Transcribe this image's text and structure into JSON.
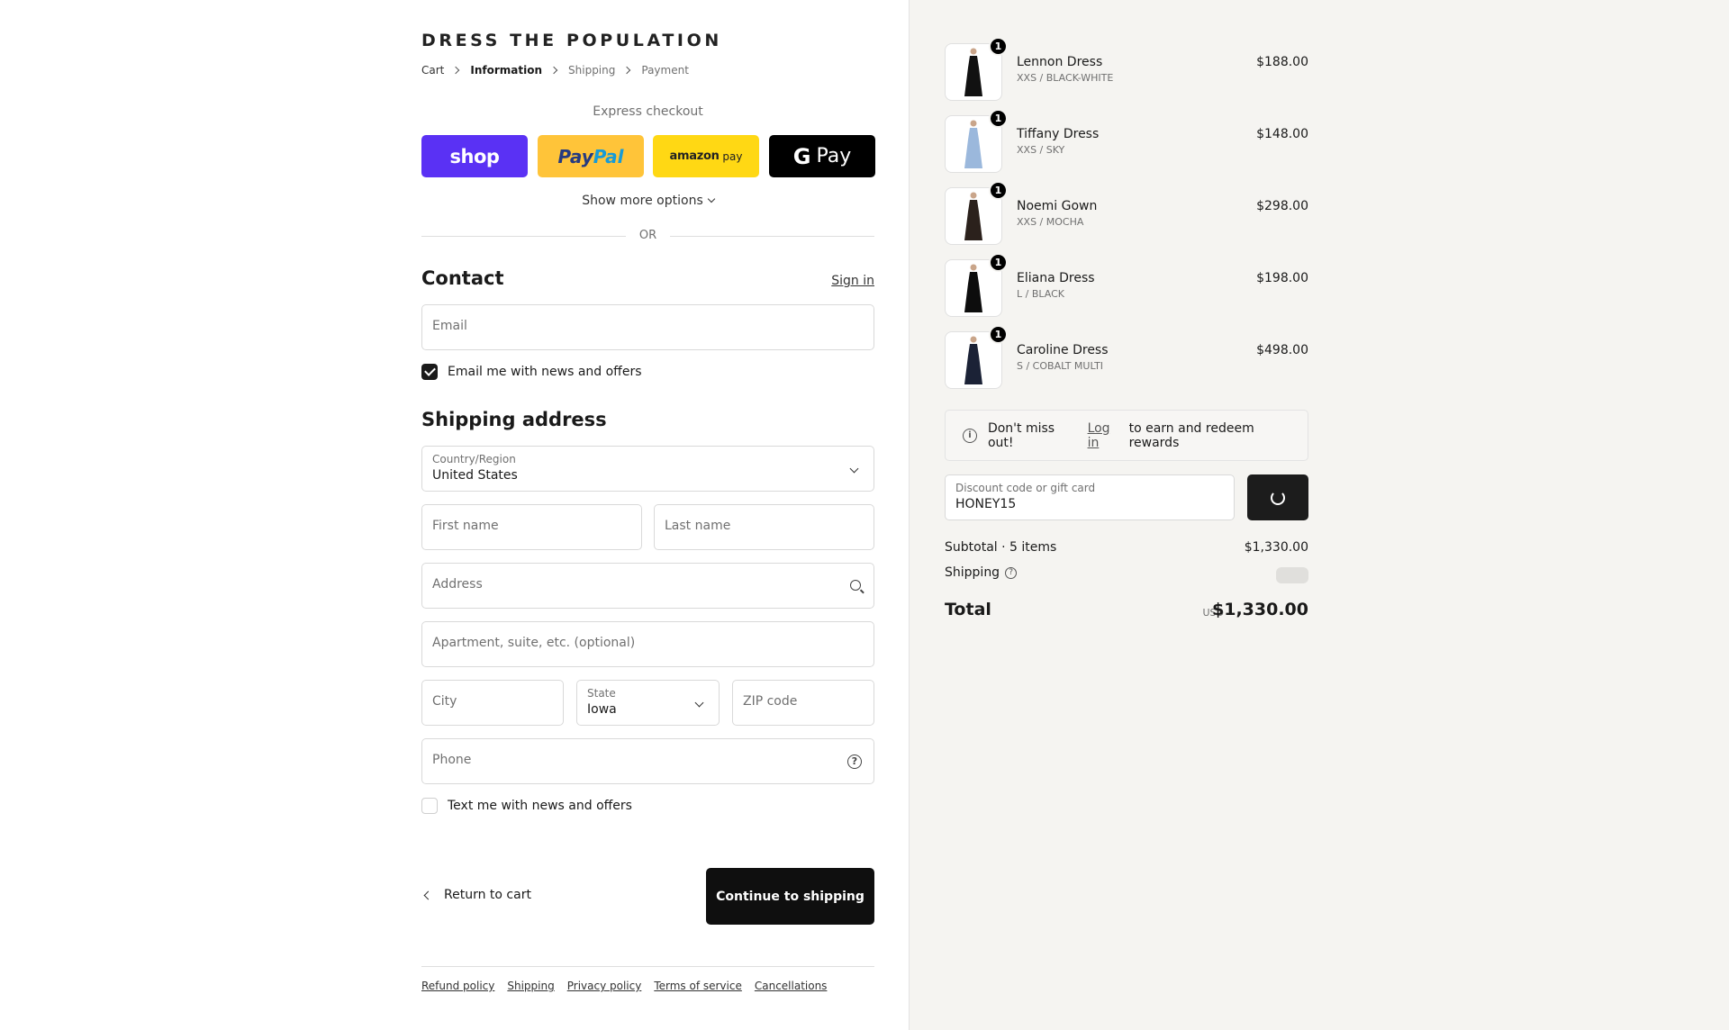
{
  "brand": "DRESS THE POPULATION",
  "breadcrumb": [
    "Cart",
    "Information",
    "Shipping",
    "Payment"
  ],
  "express": {
    "title": "Express checkout",
    "shop": "shop",
    "paypal_a": "Pay",
    "paypal_b": "Pal",
    "amazon_a": "amazon",
    "amazon_b": "pay",
    "gpay_g": "G",
    "gpay": "Pay",
    "more": "Show more options",
    "or": "OR"
  },
  "contact": {
    "heading": "Contact",
    "signin": "Sign in",
    "email_placeholder": "Email",
    "news_label": "Email me with news and offers"
  },
  "shipping_address": {
    "heading": "Shipping address",
    "country_label": "Country/Region",
    "country_value": "United States",
    "first_name": "First name",
    "last_name": "Last name",
    "address": "Address",
    "apartment": "Apartment, suite, etc. (optional)",
    "city": "City",
    "state_label": "State",
    "state_value": "Iowa",
    "zip": "ZIP code",
    "phone": "Phone",
    "text_label": "Text me with news and offers"
  },
  "actions": {
    "return": "Return to cart",
    "continue": "Continue to shipping"
  },
  "footer_links": [
    "Refund policy",
    "Shipping",
    "Privacy policy",
    "Terms of service",
    "Cancellations"
  ],
  "cart_items": [
    {
      "qty": "1",
      "name": "Lennon Dress",
      "variant": "XXS / BLACK-WHITE",
      "price": "$188.00",
      "dress_color": "#111111"
    },
    {
      "qty": "1",
      "name": "Tiffany Dress",
      "variant": "XXS / SKY",
      "price": "$148.00",
      "dress_color": "#9bb8dc"
    },
    {
      "qty": "1",
      "name": "Noemi Gown",
      "variant": "XXS / MOCHA",
      "price": "$298.00",
      "dress_color": "#2b211c"
    },
    {
      "qty": "1",
      "name": "Eliana Dress",
      "variant": "L / BLACK",
      "price": "$198.00",
      "dress_color": "#0d0d0d"
    },
    {
      "qty": "1",
      "name": "Caroline Dress",
      "variant": "S / COBALT MULTI",
      "price": "$498.00",
      "dress_color": "#1b2236"
    }
  ],
  "rewards": {
    "pre": "Don't miss out!",
    "link": "Log in",
    "post": "to earn and redeem rewards"
  },
  "discount": {
    "label": "Discount code or gift card",
    "value": "HONEY15"
  },
  "summary": {
    "subtotal_label": "Subtotal · 5 items",
    "subtotal_value": "$1,330.00",
    "shipping_label": "Shipping",
    "total_label": "Total",
    "currency": "USD",
    "total_value": "$1,330.00"
  },
  "colors": {
    "shop": "#5a31f4",
    "paypal": "#ffc439",
    "amazon": "#ffd814",
    "gpay": "#000000",
    "sidebar_bg": "#f5f4f1"
  }
}
